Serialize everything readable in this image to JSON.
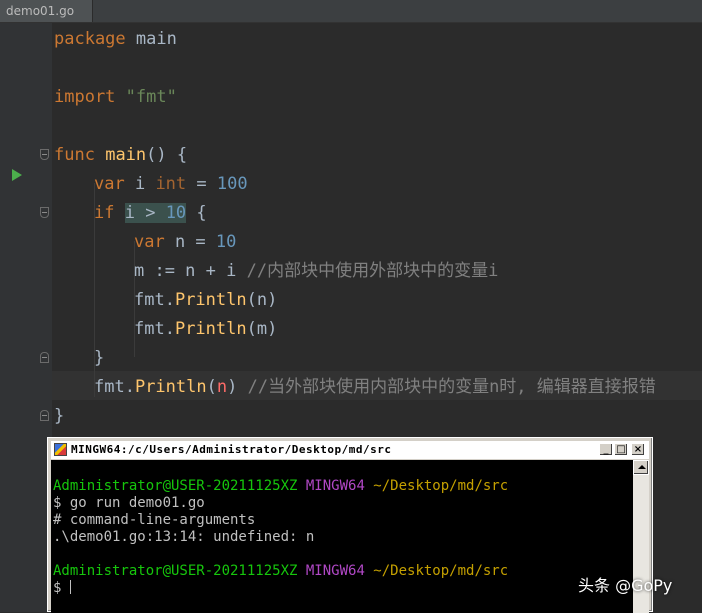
{
  "tab": {
    "label": "demo01.go"
  },
  "code": {
    "line1": {
      "kw": "package",
      "rest": " main"
    },
    "line3": {
      "kw": "import",
      "str": "\"fmt\""
    },
    "line5": {
      "kw": "func",
      "fn": "main",
      "rest": "() {"
    },
    "line6": {
      "kw": "var",
      "ident": " i ",
      "type": "int",
      "op": " = ",
      "num": "100"
    },
    "line7": {
      "kw": "if",
      "cond_a": "i > ",
      "num": "10",
      "rest": " {"
    },
    "line8": {
      "kw": "var",
      "rest": " n = ",
      "num": "10"
    },
    "line9": {
      "code": "m := n + i ",
      "comment": "//内部块中使用外部块中的变量i"
    },
    "line10": {
      "pkg": "fmt.",
      "call": "Println",
      "args": "(n)"
    },
    "line11": {
      "pkg": "fmt.",
      "call": "Println",
      "args": "(m)"
    },
    "line12": {
      "text": "}"
    },
    "line13": {
      "pkg": "fmt.",
      "call": "Println",
      "open": "(",
      "bad": "n",
      "close": ")",
      "comment": " //当外部块使用内部块中的变量n时, 编辑器直接报错"
    },
    "line14": {
      "text": "}"
    }
  },
  "terminal": {
    "title": "MINGW64:/c/Users/Administrator/Desktop/md/src",
    "buttons": {
      "minimize": "_",
      "maximize": "□",
      "close": "×"
    },
    "lines": [
      {
        "user": "Administrator@USER-20211125XZ",
        "sys": " MINGW64",
        "path": " ~/Desktop/md/src"
      },
      {
        "text": "$ go run demo01.go"
      },
      {
        "text": "# command-line-arguments"
      },
      {
        "text": ".\\demo01.go:13:14: undefined: n"
      },
      {
        "user": "Administrator@USER-20211125XZ",
        "sys": " MINGW64",
        "path": " ~/Desktop/md/src"
      },
      {
        "text": "$ "
      }
    ]
  },
  "watermark": "头条 @GoPy",
  "colors": {
    "editor_bg": "#2b2b2b",
    "keyword": "#cc7832",
    "string": "#6a8759",
    "number": "#6897bb",
    "function": "#ffc66d",
    "comment": "#808080",
    "error": "#ff6b68",
    "term_user": "#16c60c",
    "term_mingw": "#b148c6",
    "term_path": "#c4a000"
  }
}
